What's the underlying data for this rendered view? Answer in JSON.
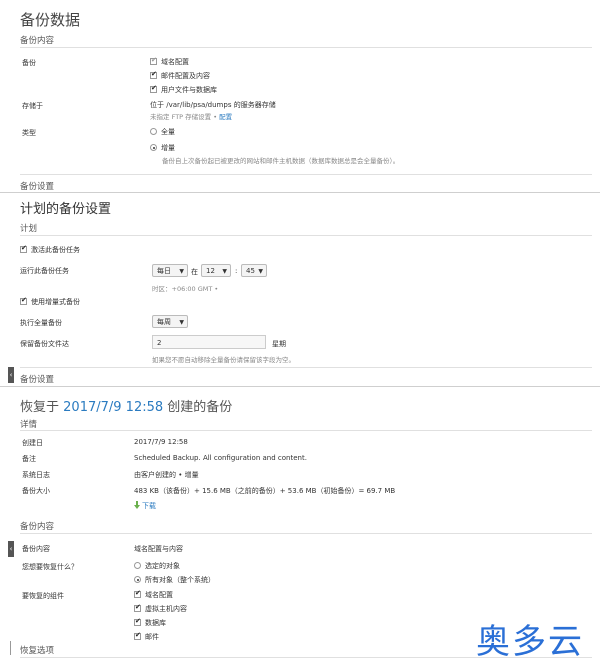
{
  "panel1": {
    "title": "备份数据",
    "section": "备份内容",
    "backup_label": "备份",
    "backup_options": [
      {
        "label": "域名配置",
        "checked": true,
        "disabled": true
      },
      {
        "label": "邮件配置及内容",
        "checked": true,
        "disabled": false
      },
      {
        "label": "用户文件与数据库",
        "checked": true,
        "disabled": false
      }
    ],
    "store_label": "存储于",
    "store_value": "位于 /var/lib/psa/dumps 的服务器存储",
    "ftp_note": "未指定 FTP 存储设置 •",
    "ftp_link": "配置",
    "type_label": "类型",
    "type_full": "全量",
    "type_incremental": "增量",
    "incremental_hint": "备份自上次备份起已被更改的网站和邮件主机数据（数据库数据总是会全量备份）。",
    "footer": "备份设置"
  },
  "panel2": {
    "title": "计划的备份设置",
    "section": "计划",
    "activate_label": "激活此备份任务",
    "run_label": "运行此备份任务",
    "frequency": "每日",
    "at": "在",
    "hour": "12",
    "colon": ":",
    "minute": "45",
    "timezone": "时区：+06:00 GMT •",
    "incremental_label": "使用增量式备份",
    "full_label": "执行全量备份",
    "full_value": "每周",
    "keep_label": "保留备份文件达",
    "keep_value": "2",
    "keep_unit": "星期",
    "keep_hint": "如果您不愿自动移除全量备份请保留该字段为空。",
    "footer": "备份设置"
  },
  "panel3": {
    "title_prefix": "恢复于",
    "title_date": "2017/7/9 12:58",
    "title_suffix": "创建的备份",
    "details_section": "详情",
    "rows": [
      {
        "label": "创建日",
        "value": "2017/7/9 12:58"
      },
      {
        "label": "备注",
        "value": "Scheduled Backup. All configuration and content."
      },
      {
        "label": "系统日志",
        "value": "由客户创建的 • 增量"
      },
      {
        "label": "备份大小",
        "value": "483 KB（该备份）+ 15.6 MB（之前的备份）+ 53.6 MB（初始备份）= 69.7 MB"
      }
    ],
    "download": "下载",
    "content_section": "备份内容",
    "content_label": "备份内容",
    "content_value": "域名配置与内容",
    "restore_what_label": "您想要恢复什么？",
    "restore_opt_selected": "选定的对象",
    "restore_opt_all": "所有对象（整个系统）",
    "components_label": "要恢复的组件",
    "components": [
      {
        "label": "域名配置",
        "checked": true
      },
      {
        "label": "虚拟主机内容",
        "checked": true
      },
      {
        "label": "数据库",
        "checked": true
      },
      {
        "label": "邮件",
        "checked": true
      }
    ],
    "restore_options": "恢复选项"
  },
  "watermark": "奥多云"
}
